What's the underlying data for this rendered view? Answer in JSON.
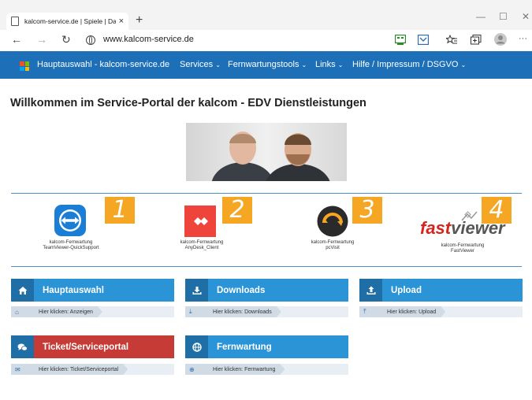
{
  "browser": {
    "tab_title": "kalcom-service.de | Spiele | Das S",
    "tab_close": "×",
    "new_tab": "+",
    "url": "www.kalcom-service.de",
    "minimize": "—",
    "maximize": "☐",
    "close": "✕",
    "more": "···"
  },
  "nav": {
    "items": [
      {
        "label": "Hauptauswahl - kalcom-service.de",
        "dropdown": false
      },
      {
        "label": "Services",
        "dropdown": true
      },
      {
        "label": "Fernwartungstools",
        "dropdown": true
      },
      {
        "label": "Links",
        "dropdown": true
      },
      {
        "label": "Hilfe / Impressum / DSGVO",
        "dropdown": true
      }
    ],
    "caret": "⌄"
  },
  "main": {
    "title": "Willkommen im Service-Portal der kalcom - EDV Dienstleistungen",
    "tools": [
      {
        "number": "1",
        "caption_line1": "kalcom-Fernwartung",
        "caption_line2": "TeamViewer-QuickSupport",
        "icon": "teamviewer-icon"
      },
      {
        "number": "2",
        "caption_line1": "kalcom-Fernwartung",
        "caption_line2": "AnyDesk_Client",
        "icon": "anydesk-icon"
      },
      {
        "number": "3",
        "caption_line1": "kalcom-Fernwartung",
        "caption_line2": "pcVisit",
        "icon": "pcvisit-icon"
      },
      {
        "number": "4",
        "caption_line1": "kalcom-Fernwartung",
        "caption_line2": "FastViewer",
        "icon": "fastviewer-icon",
        "logo_fast": "fast",
        "logo_viewer": "viewer"
      }
    ],
    "services": [
      {
        "title": "Hauptauswahl",
        "link": "Hier klicken: Anzeigen",
        "icon": "home-icon",
        "color": "#2a94d6",
        "icon_bg": "#1f6fa6"
      },
      {
        "title": "Downloads",
        "link": "Hier klicken: Downloads",
        "icon": "download-icon",
        "color": "#2a94d6",
        "icon_bg": "#1f6fa6"
      },
      {
        "title": "Upload",
        "link": "Hier klicken: Upload",
        "icon": "upload-icon",
        "color": "#2a94d6",
        "icon_bg": "#1f6fa6"
      },
      {
        "title": "Ticket/Serviceportal",
        "link": "Hier klicken: Ticket/Serviceportal",
        "icon": "chat-icon",
        "color": "#c63b35",
        "icon_bg": "#1f6fa6"
      },
      {
        "title": "Fernwartung",
        "link": "Hier klicken: Fernwartung",
        "icon": "globe-icon",
        "color": "#2a94d6",
        "icon_bg": "#1f6fa6"
      }
    ]
  }
}
